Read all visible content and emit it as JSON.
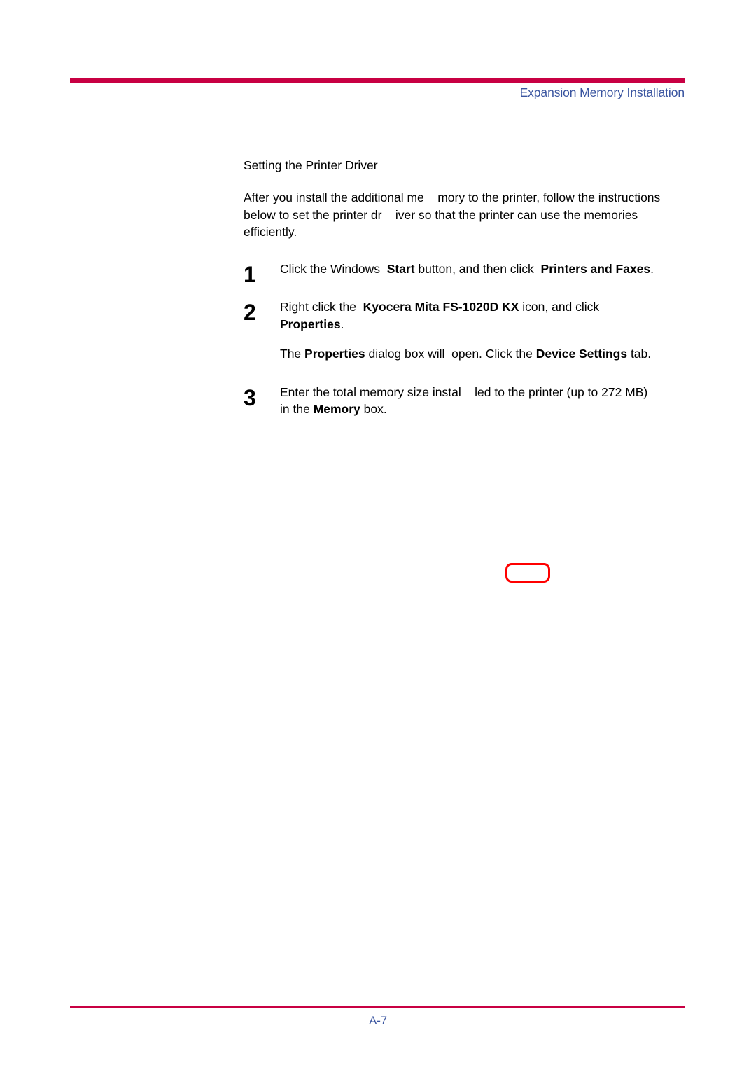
{
  "header": {
    "title": "Expansion Memory Installation",
    "rule_color": "#c80043",
    "title_color": "#3a55a0"
  },
  "content": {
    "section_heading": "Setting the Printer Driver",
    "intro": "After you install the additional me    mory to the printer, follow the instructions below to set the printer dr    iver so that the printer can use the memories efficiently."
  },
  "steps": [
    {
      "number": "1",
      "text_1": "Click the Windows  ",
      "bold_1": "Start",
      "text_2": " button, and then click  ",
      "bold_2": "Printers and Faxes",
      "text_3": "."
    },
    {
      "number": "2",
      "text_1": "Right click the  ",
      "bold_1": "Kyocera Mita FS-1020D KX",
      "text_2": " icon, and click\n",
      "bold_2": "Properties",
      "text_3": "."
    },
    {
      "number": "3",
      "text_1": "Enter the total memory size instal    led to the printer (up to 272 MB)\nin the ",
      "bold_1": "Memory",
      "text_2": " box.",
      "bold_2": "",
      "text_3": ""
    }
  ],
  "note": {
    "text_1": "The ",
    "bold_1": "Properties",
    "text_2": " dialog box will  open. Click the ",
    "bold_2": "Device Settings",
    "text_3": " tab."
  },
  "annotation": {
    "callout_color": "#ff0000"
  },
  "footer": {
    "page_number": "A-7",
    "rule_color": "#c80043",
    "page_number_color": "#3a55a0"
  }
}
